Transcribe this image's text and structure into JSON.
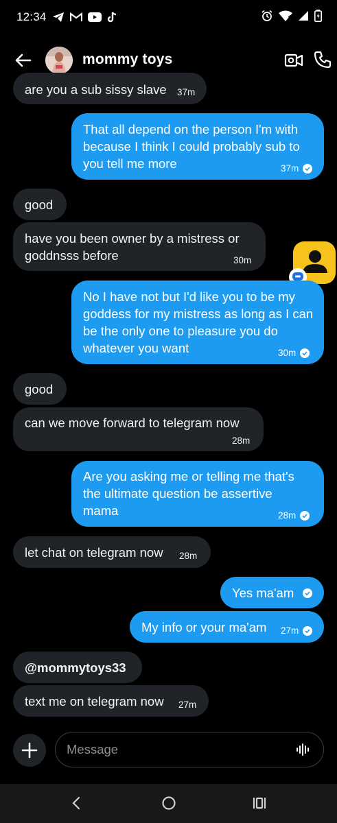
{
  "status_bar": {
    "time": "12:34",
    "left_icons": [
      "telegram-icon",
      "gmail-icon",
      "youtube-icon",
      "tiktok-icon"
    ],
    "right_icons": [
      "alarm-icon",
      "wifi-icon",
      "signal-icon",
      "battery-icon"
    ]
  },
  "header": {
    "title": "mommy toys",
    "icons": [
      "back-arrow-icon",
      "avatar",
      "video-call-icon",
      "phone-icon"
    ]
  },
  "messages": [
    {
      "side": "in",
      "text": "are you a sub sissy slave",
      "time": "37m"
    },
    {
      "side": "out",
      "text": "That all depend on the person I'm with because I think I could probably sub to you tell me more",
      "time": "37m"
    },
    {
      "side": "in",
      "text": "good",
      "time": ""
    },
    {
      "side": "in",
      "text": "have you been owner by a mistress or goddnsss before",
      "time": "30m"
    },
    {
      "side": "out",
      "text": "No I have not but I'd like you to be my goddess for my mistress as long as I can be the only one to pleasure you do whatever you want",
      "time": "30m"
    },
    {
      "side": "in",
      "text": "good",
      "time": ""
    },
    {
      "side": "in",
      "text": "can we move forward to telegram now",
      "time": "28m"
    },
    {
      "side": "out",
      "text": "Are you asking me or telling me that's the ultimate question be assertive mama",
      "time": "28m"
    },
    {
      "side": "in",
      "text": "let chat on telegram now",
      "time": "28m"
    },
    {
      "side": "out",
      "text": "Yes ma'am",
      "time": ""
    },
    {
      "side": "out",
      "text": "My info or your ma'am",
      "time": "27m"
    },
    {
      "side": "in",
      "text": "@mommytoys33",
      "time": ""
    },
    {
      "side": "in",
      "text": "text me on telegram now",
      "time": "27m"
    }
  ],
  "composer": {
    "placeholder": "Message",
    "icons": [
      "plus-icon",
      "voice-icon"
    ]
  },
  "nav_bar": {
    "icons": [
      "nav-back-icon",
      "nav-home-icon",
      "nav-recents-icon"
    ]
  },
  "colors": {
    "background": "#000000",
    "incoming_bubble": "#202327",
    "outgoing_bubble": "#1d9bf0",
    "floating_app": "#f7c21b"
  }
}
